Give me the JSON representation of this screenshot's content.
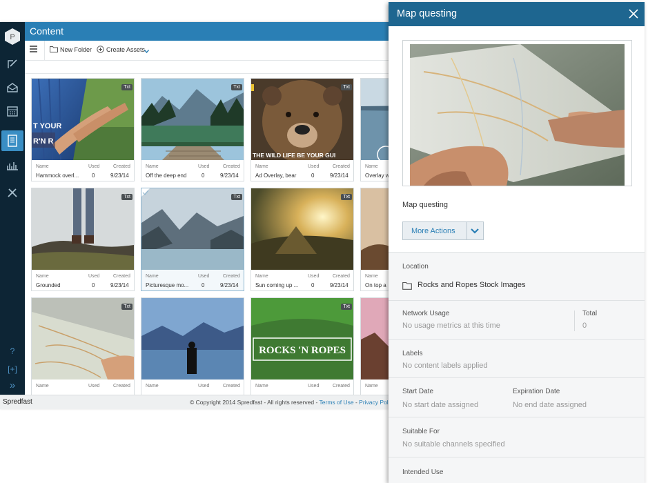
{
  "rail": {
    "logo_letter": "P",
    "bottom_help": "?",
    "bottom_add": "[+]",
    "bottom_expand": "»"
  },
  "header": {
    "title": "Content"
  },
  "toolbar": {
    "new_folder": "New Folder",
    "create_assets": "Create Assets"
  },
  "grid": {
    "col_name": "Name",
    "col_used": "Used",
    "col_created": "Created",
    "badge": "Txt",
    "cards": [
      {
        "name": "Hammock overl...",
        "used": "0",
        "created": "9/23/14"
      },
      {
        "name": "Off the deep end",
        "used": "0",
        "created": "9/23/14"
      },
      {
        "name": "Ad Overlay, bear",
        "used": "0",
        "created": "9/23/14"
      },
      {
        "name": "Overlay w",
        "used": "",
        "created": ""
      },
      {
        "name": "Grounded",
        "used": "0",
        "created": "9/23/14"
      },
      {
        "name": "Picturesque mo...",
        "used": "0",
        "created": "9/23/14"
      },
      {
        "name": "Sun coming up ...",
        "used": "0",
        "created": "9/23/14"
      },
      {
        "name": "On top a",
        "used": "",
        "created": ""
      },
      {
        "name": "",
        "used": "",
        "created": ""
      },
      {
        "name": "",
        "used": "",
        "created": ""
      },
      {
        "name": "",
        "used": "",
        "created": ""
      },
      {
        "name": "",
        "used": "",
        "created": ""
      }
    ],
    "overlay_texts": {
      "hammock_line1": "T YOUR",
      "hammock_line2": "R'N R",
      "bear": "THE WILD LIFE BE YOUR GUI",
      "rocks": "ROCKS 'N ROPES"
    }
  },
  "footer": {
    "brand": "Spredfast",
    "copyright": "© Copyright 2014 Spredfast - All rights reserved - ",
    "terms": "Terms of Use",
    "dash": " - ",
    "privacy": "Privacy Polic"
  },
  "panel": {
    "title": "Map questing",
    "asset_name": "Map questing",
    "more_actions": "More Actions",
    "location_label": "Location",
    "location_value": "Rocks and Ropes Stock Images",
    "network_label": "Network Usage",
    "network_value": "No usage metrics at this time",
    "total_label": "Total",
    "total_value": "0",
    "labels_label": "Labels",
    "labels_value": "No content labels applied",
    "start_label": "Start Date",
    "start_value": "No start date assigned",
    "exp_label": "Expiration Date",
    "exp_value": "No end date assigned",
    "suitable_label": "Suitable For",
    "suitable_value": "No suitable channels specified",
    "intended_label": "Intended Use"
  },
  "icons": [
    "logo-icon",
    "compose-icon",
    "inbox-icon",
    "calendar-icon",
    "content-icon",
    "analytics-icon",
    "tools-icon",
    "help-icon",
    "add-icon",
    "expand-icon",
    "menu-icon",
    "folder-icon",
    "plus-circle-icon",
    "chevron-down-icon",
    "close-icon"
  ],
  "colors": {
    "accent": "#2a7fb5",
    "rail": "#0d2535",
    "panel_header": "#1e6690"
  }
}
